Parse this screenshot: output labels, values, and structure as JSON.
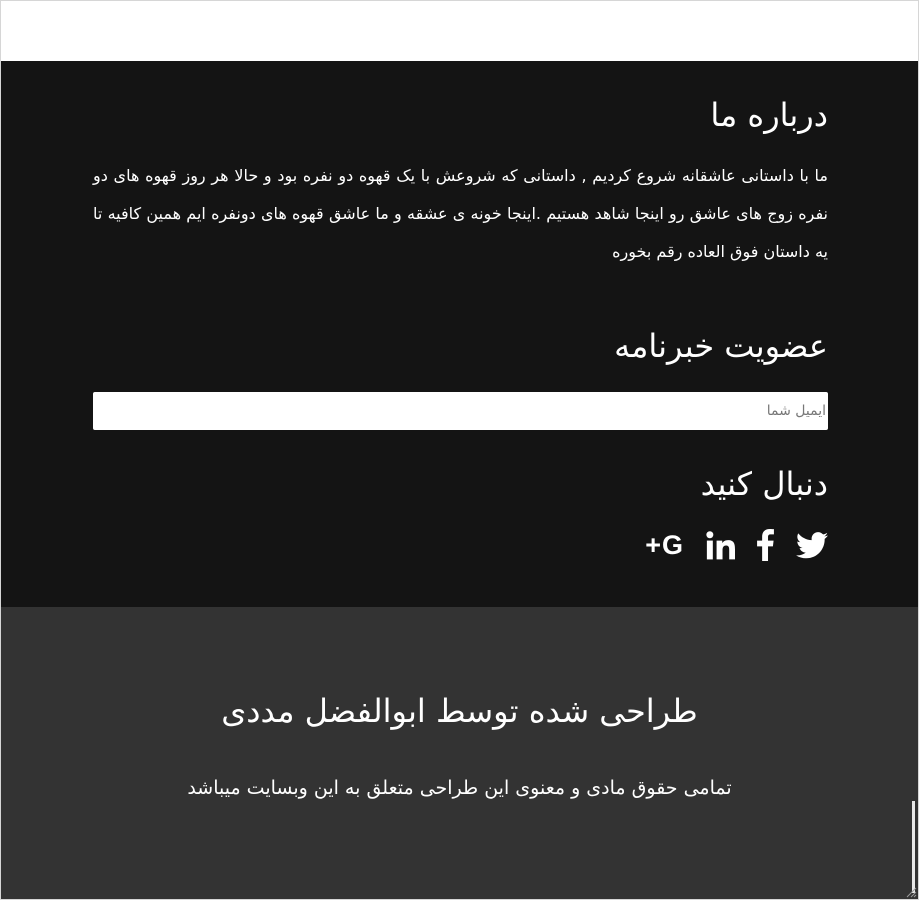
{
  "about": {
    "title": "درباره ما",
    "text": "ما با داستانی عاشقانه شروع کردیم , داستانی که شروعش با یک قهوه دو نفره بود و حالا هر روز قهوه های دو نفره زوج های عاشق رو اینجا شاهد هستیم .اینجا خونه ی عشقه و ما عاشق قهوه های دونفره ایم همین کافیه تا یه داستان فوق العاده رقم بخوره"
  },
  "newsletter": {
    "title": "عضویت خبرنامه",
    "email_value": "",
    "email_placeholder": "ایمیل شما"
  },
  "follow": {
    "title": "دنبال کنید",
    "icons": [
      "twitter-icon",
      "facebook-icon",
      "linkedin-icon",
      "google-plus-icon"
    ],
    "google_plus_label": "G+"
  },
  "credits": {
    "designer": "طراحی شده توسط ابوالفضل مددی",
    "rights": "تمامی حقوق مادی و معنوی این طراحی متعلق به این وبسایت میباشد"
  },
  "colors": {
    "footer_main_bg": "#141414",
    "footer_bottom_bg": "#333333",
    "text": "#ffffff"
  }
}
